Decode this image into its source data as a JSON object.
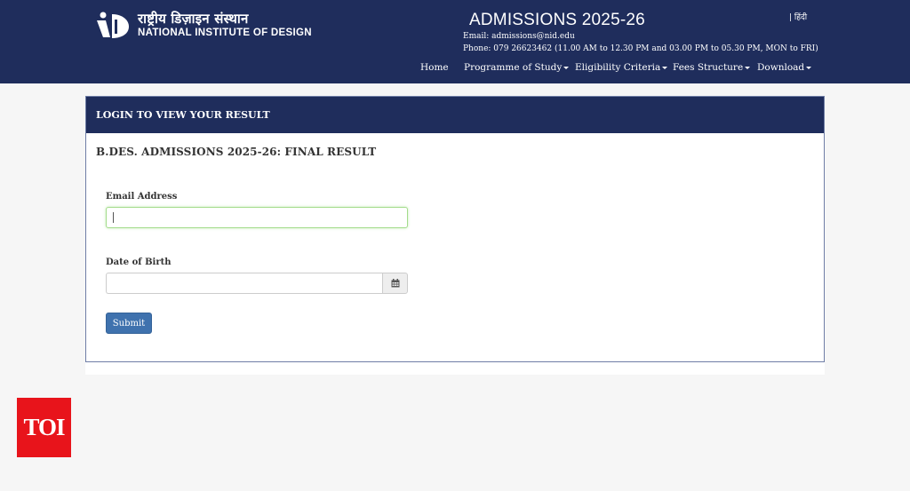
{
  "header": {
    "logo_hindi": "राष्ट्रीय डिज़ाइन संस्थान",
    "logo_english": "NATIONAL INSTITUTE OF DESIGN",
    "lang_switch": "| हिंदी",
    "title": "ADMISSIONS 2025-26",
    "email": "Email: admissions@nid.edu",
    "phone": "Phone: 079 26623462 (11.00 AM to 12.30 PM and 03.00 PM to 05.30 PM, MON to FRI)",
    "nav": [
      {
        "label": "Home",
        "dropdown": false
      },
      {
        "label": "Programme of Study",
        "dropdown": true
      },
      {
        "label": "Eligibility Criteria",
        "dropdown": true
      },
      {
        "label": "Fees Structure",
        "dropdown": true
      },
      {
        "label": "Download",
        "dropdown": true
      }
    ]
  },
  "panel": {
    "heading": "LOGIN TO VIEW YOUR RESULT",
    "result_title": "B.DES. ADMISSIONS 2025-26: FINAL RESULT",
    "email_label": "Email Address",
    "email_value": "",
    "dob_label": "Date of Birth",
    "dob_value": "",
    "submit_label": "Submit",
    "calendar_icon": "calendar-icon"
  },
  "badge": {
    "text": "TOI",
    "color": "#e8141b"
  },
  "colors": {
    "header_bg": "#1f2d5c",
    "button_bg": "#3f72ae",
    "focus_border": "#a4dc8c"
  }
}
